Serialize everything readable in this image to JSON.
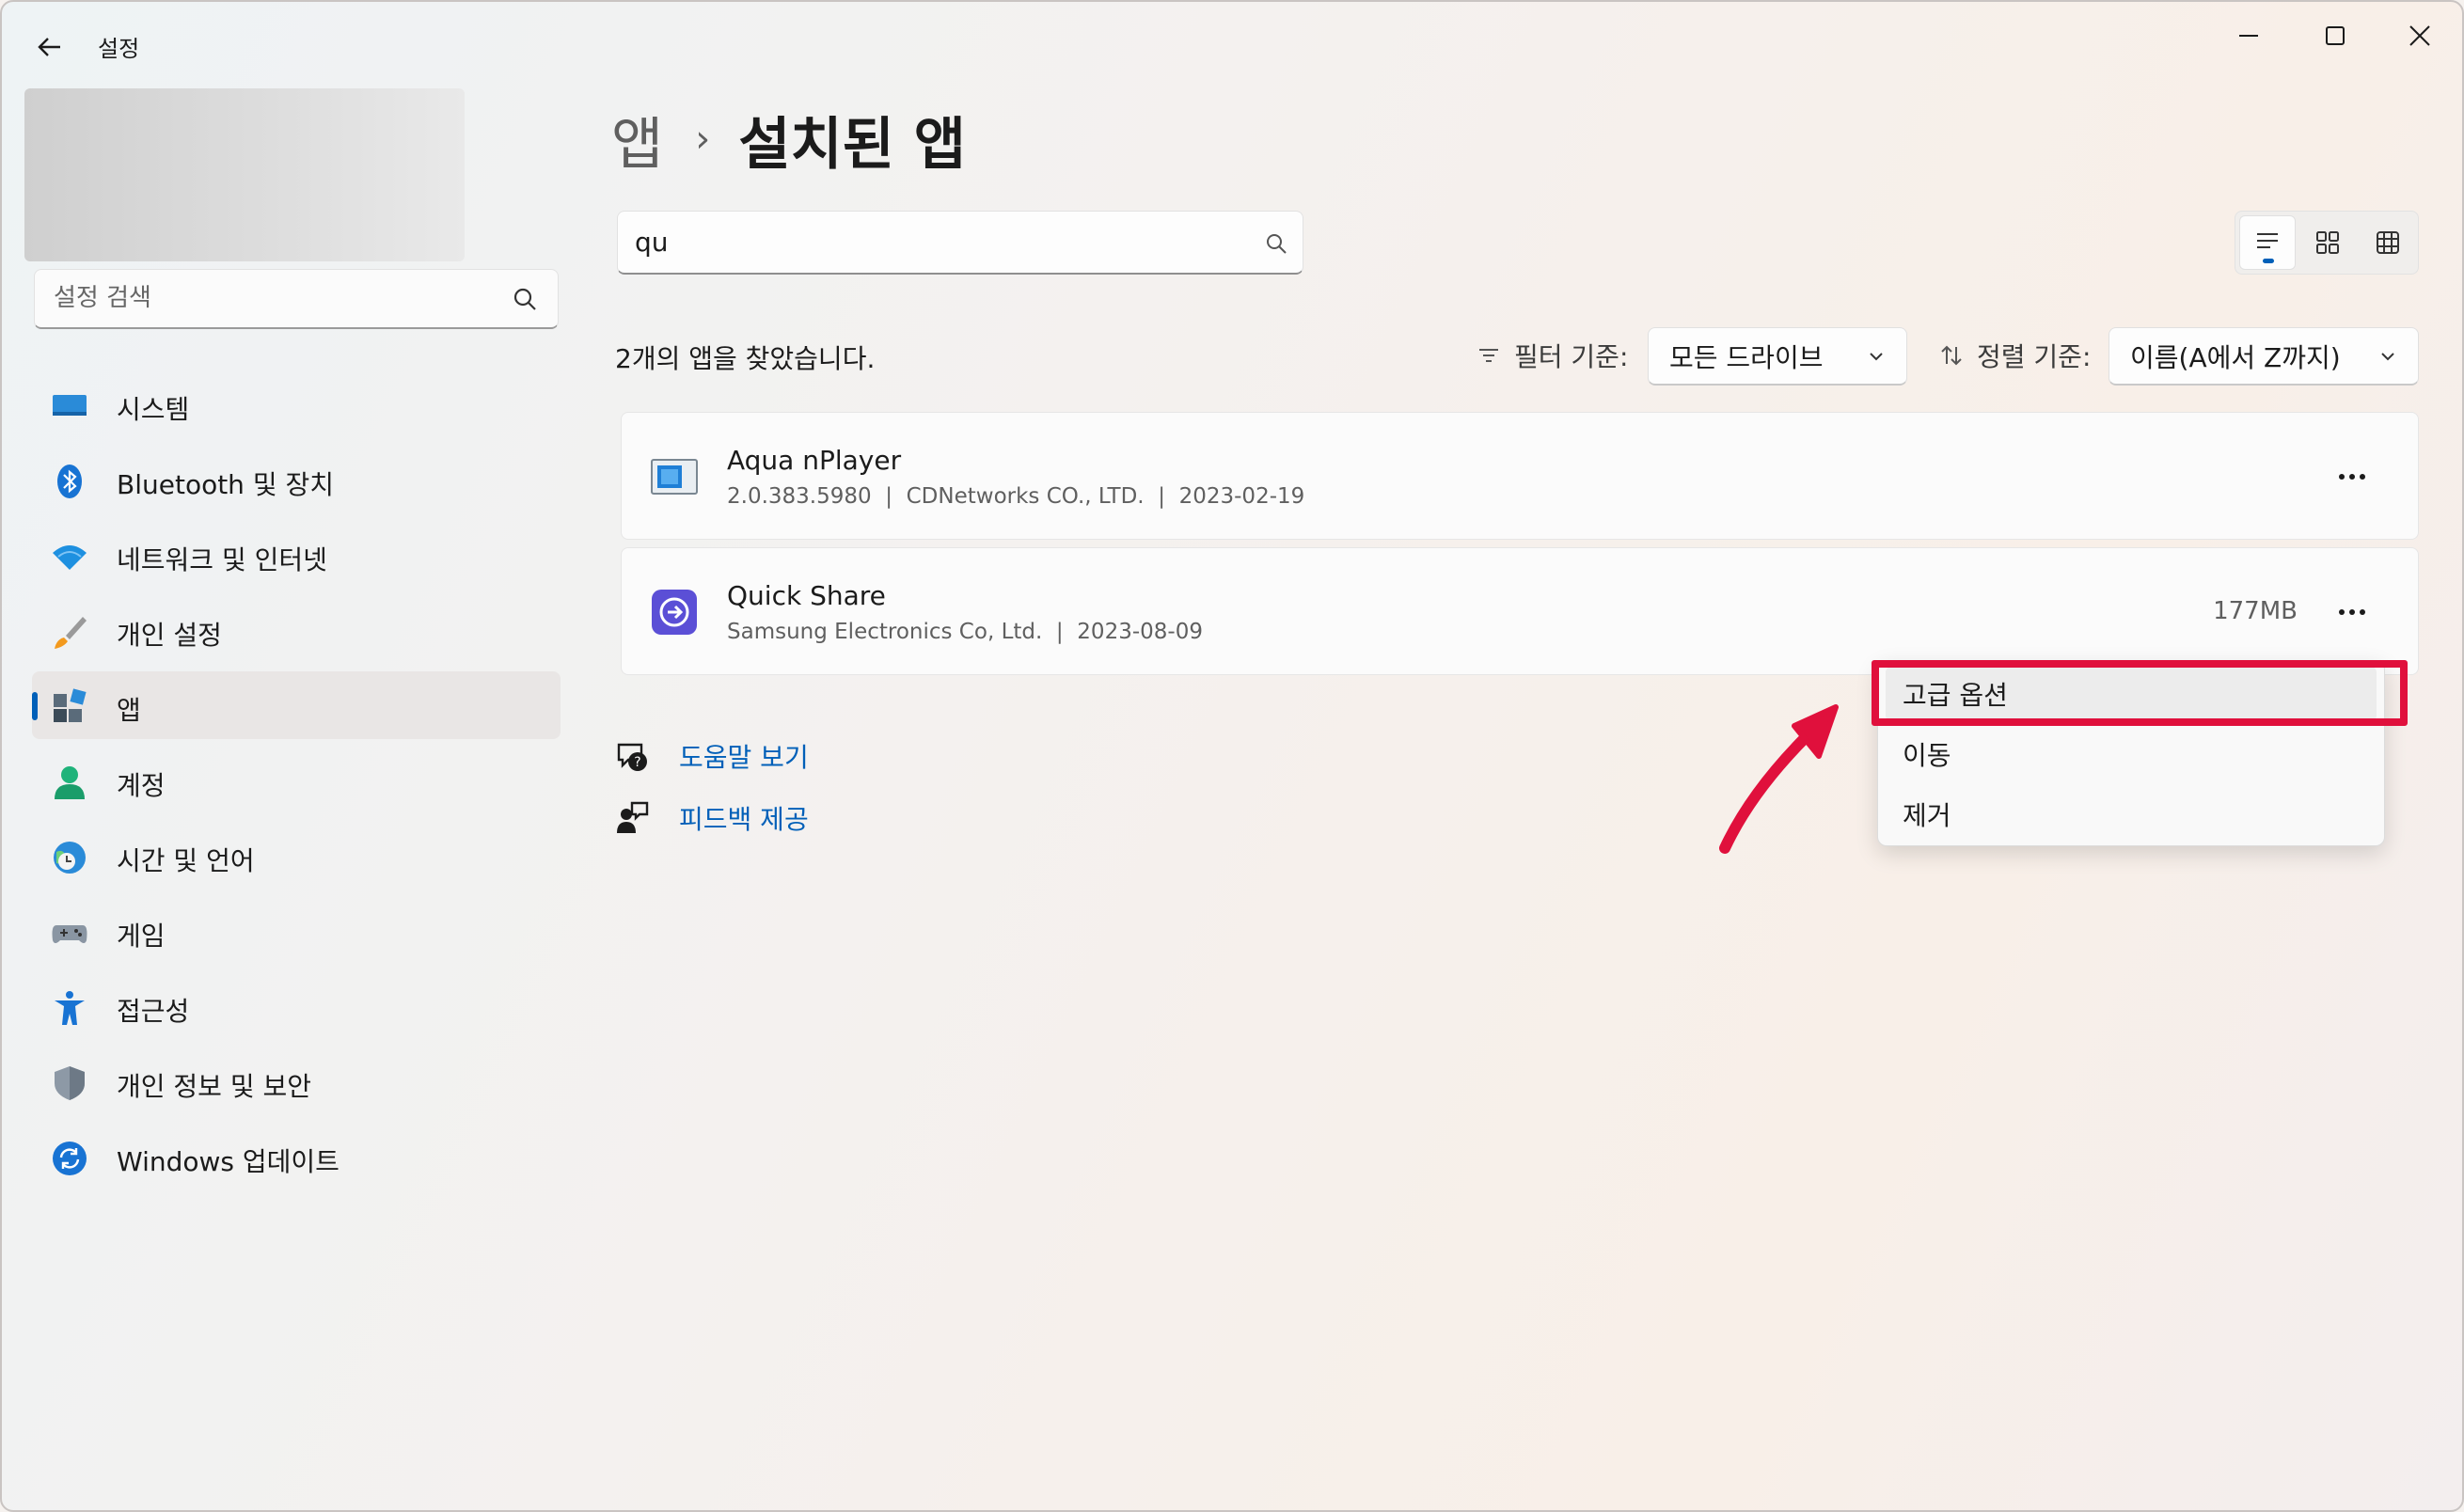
{
  "window": {
    "title": "설정",
    "controls": {
      "minimize_icon": "minimize-icon",
      "maximize_icon": "maximize-icon",
      "close_icon": "close-icon"
    }
  },
  "sidebar": {
    "search_placeholder": "설정 검색",
    "items": [
      {
        "label": "시스템",
        "icon": "system-icon",
        "active": false
      },
      {
        "label": "Bluetooth 및 장치",
        "icon": "bluetooth-icon",
        "active": false
      },
      {
        "label": "네트워크 및 인터넷",
        "icon": "wifi-icon",
        "active": false
      },
      {
        "label": "개인 설정",
        "icon": "brush-icon",
        "active": false
      },
      {
        "label": "앱",
        "icon": "apps-icon",
        "active": true
      },
      {
        "label": "계정",
        "icon": "account-icon",
        "active": false
      },
      {
        "label": "시간 및 언어",
        "icon": "time-language-icon",
        "active": false
      },
      {
        "label": "게임",
        "icon": "gamepad-icon",
        "active": false
      },
      {
        "label": "접근성",
        "icon": "accessibility-icon",
        "active": false
      },
      {
        "label": "개인 정보 및 보안",
        "icon": "shield-icon",
        "active": false
      },
      {
        "label": "Windows 업데이트",
        "icon": "update-icon",
        "active": false
      }
    ]
  },
  "breadcrumb": {
    "parent": "앱",
    "separator": "›",
    "current": "설치된 앱"
  },
  "search": {
    "value": "qu"
  },
  "results": {
    "found_text": "2개의 앱을 찾았습니다.",
    "filter_label": "필터 기준:",
    "filter_value": "모든 드라이브",
    "sort_label": "정렬 기준:",
    "sort_value": "이름(A에서 Z까지)"
  },
  "apps": [
    {
      "name": "Aqua nPlayer",
      "meta": "2.0.383.5980  |  CDNetworks CO., LTD.  |  2023-02-19",
      "size": ""
    },
    {
      "name": "Quick Share",
      "meta": "Samsung Electronics Co, Ltd.  |  2023-08-09",
      "size": "177MB"
    }
  ],
  "context_menu": {
    "items": [
      "고급 옵션",
      "이동",
      "제거"
    ]
  },
  "links": {
    "help": "도움말 보기",
    "feedback": "피드백 제공"
  },
  "colors": {
    "accent": "#005fb8",
    "annotation": "#e0103c"
  }
}
